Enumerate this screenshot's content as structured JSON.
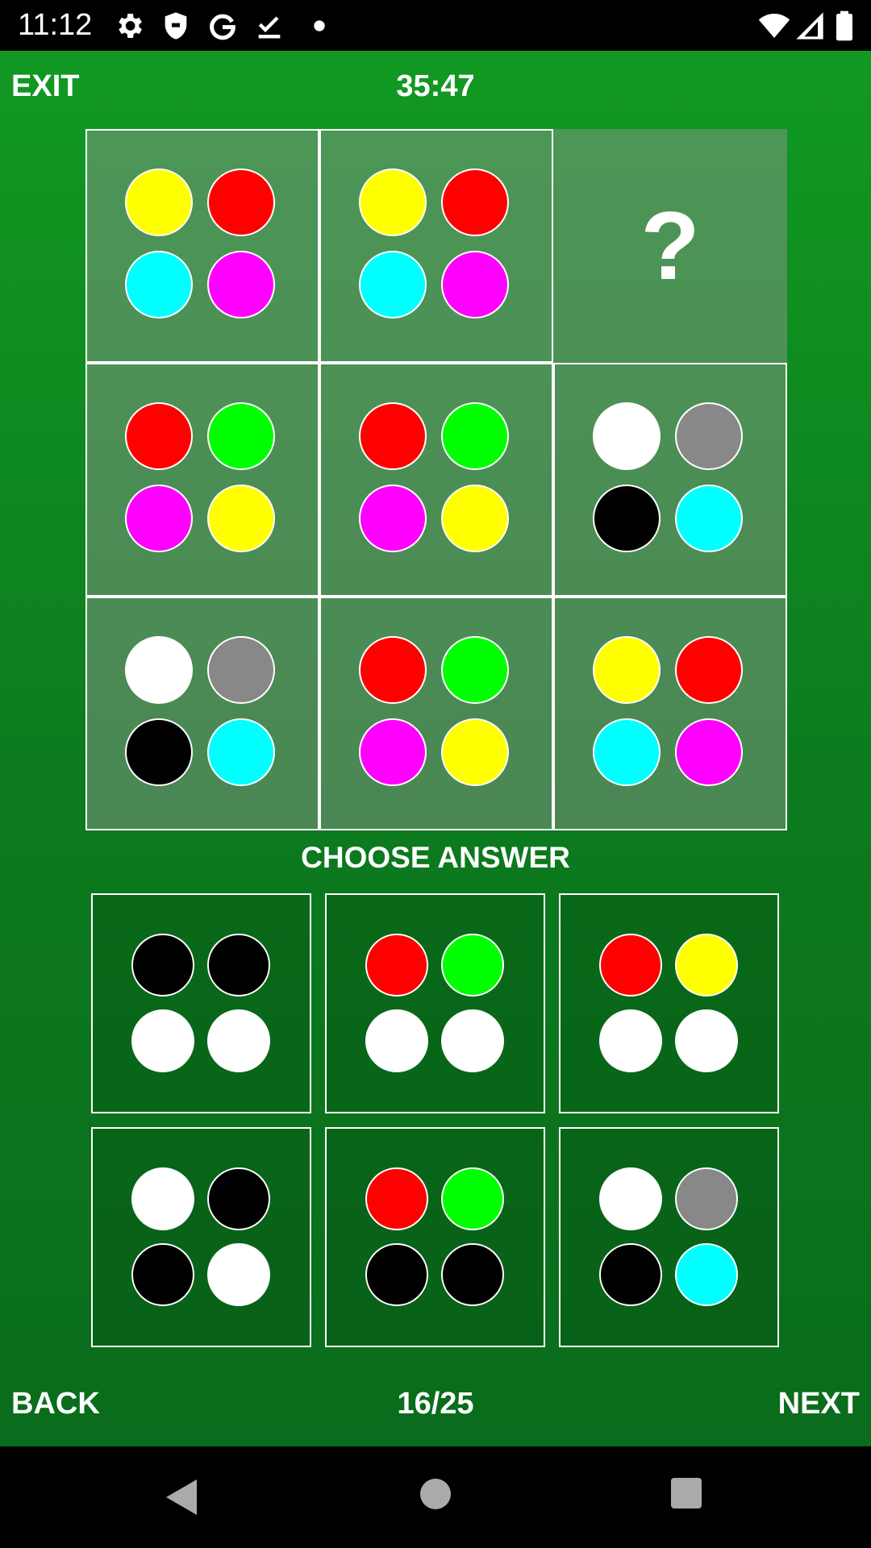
{
  "status_bar": {
    "time": "11:12",
    "left_icons": [
      "gear-icon",
      "shield-icon",
      "google-g-icon",
      "download-done-icon",
      "dot-icon"
    ],
    "right_icons": [
      "wifi-icon",
      "cell-signal-icon",
      "battery-icon"
    ]
  },
  "header": {
    "exit_label": "EXIT",
    "timer": "35:47"
  },
  "colors": {
    "yellow": "#ffff00",
    "red": "#ff0000",
    "cyan": "#00ffff",
    "magenta": "#ff00ff",
    "green": "#00ff00",
    "white": "#ffffff",
    "gray": "#888888",
    "black": "#000000"
  },
  "matrix": {
    "question_mark": "?",
    "cells": [
      [
        "yellow",
        "red",
        "cyan",
        "magenta"
      ],
      [
        "yellow",
        "red",
        "cyan",
        "magenta"
      ],
      null,
      [
        "red",
        "green",
        "magenta",
        "yellow"
      ],
      [
        "red",
        "green",
        "magenta",
        "yellow"
      ],
      [
        "white",
        "gray",
        "black",
        "cyan"
      ],
      [
        "white",
        "gray",
        "black",
        "cyan"
      ],
      [
        "red",
        "green",
        "magenta",
        "yellow"
      ],
      [
        "yellow",
        "red",
        "cyan",
        "magenta"
      ]
    ]
  },
  "choose_answer_label": "CHOOSE ANSWER",
  "answers": [
    [
      "black",
      "black",
      "white",
      "white"
    ],
    [
      "red",
      "green",
      "white",
      "white"
    ],
    [
      "red",
      "yellow",
      "white",
      "white"
    ],
    [
      "white",
      "black",
      "black",
      "white"
    ],
    [
      "red",
      "green",
      "black",
      "black"
    ],
    [
      "white",
      "gray",
      "black",
      "cyan"
    ]
  ],
  "footer": {
    "back_label": "BACK",
    "progress": "16/25",
    "next_label": "NEXT"
  },
  "nav_bar": {
    "icons": [
      "back-triangle-icon",
      "home-circle-icon",
      "recents-square-icon"
    ]
  }
}
